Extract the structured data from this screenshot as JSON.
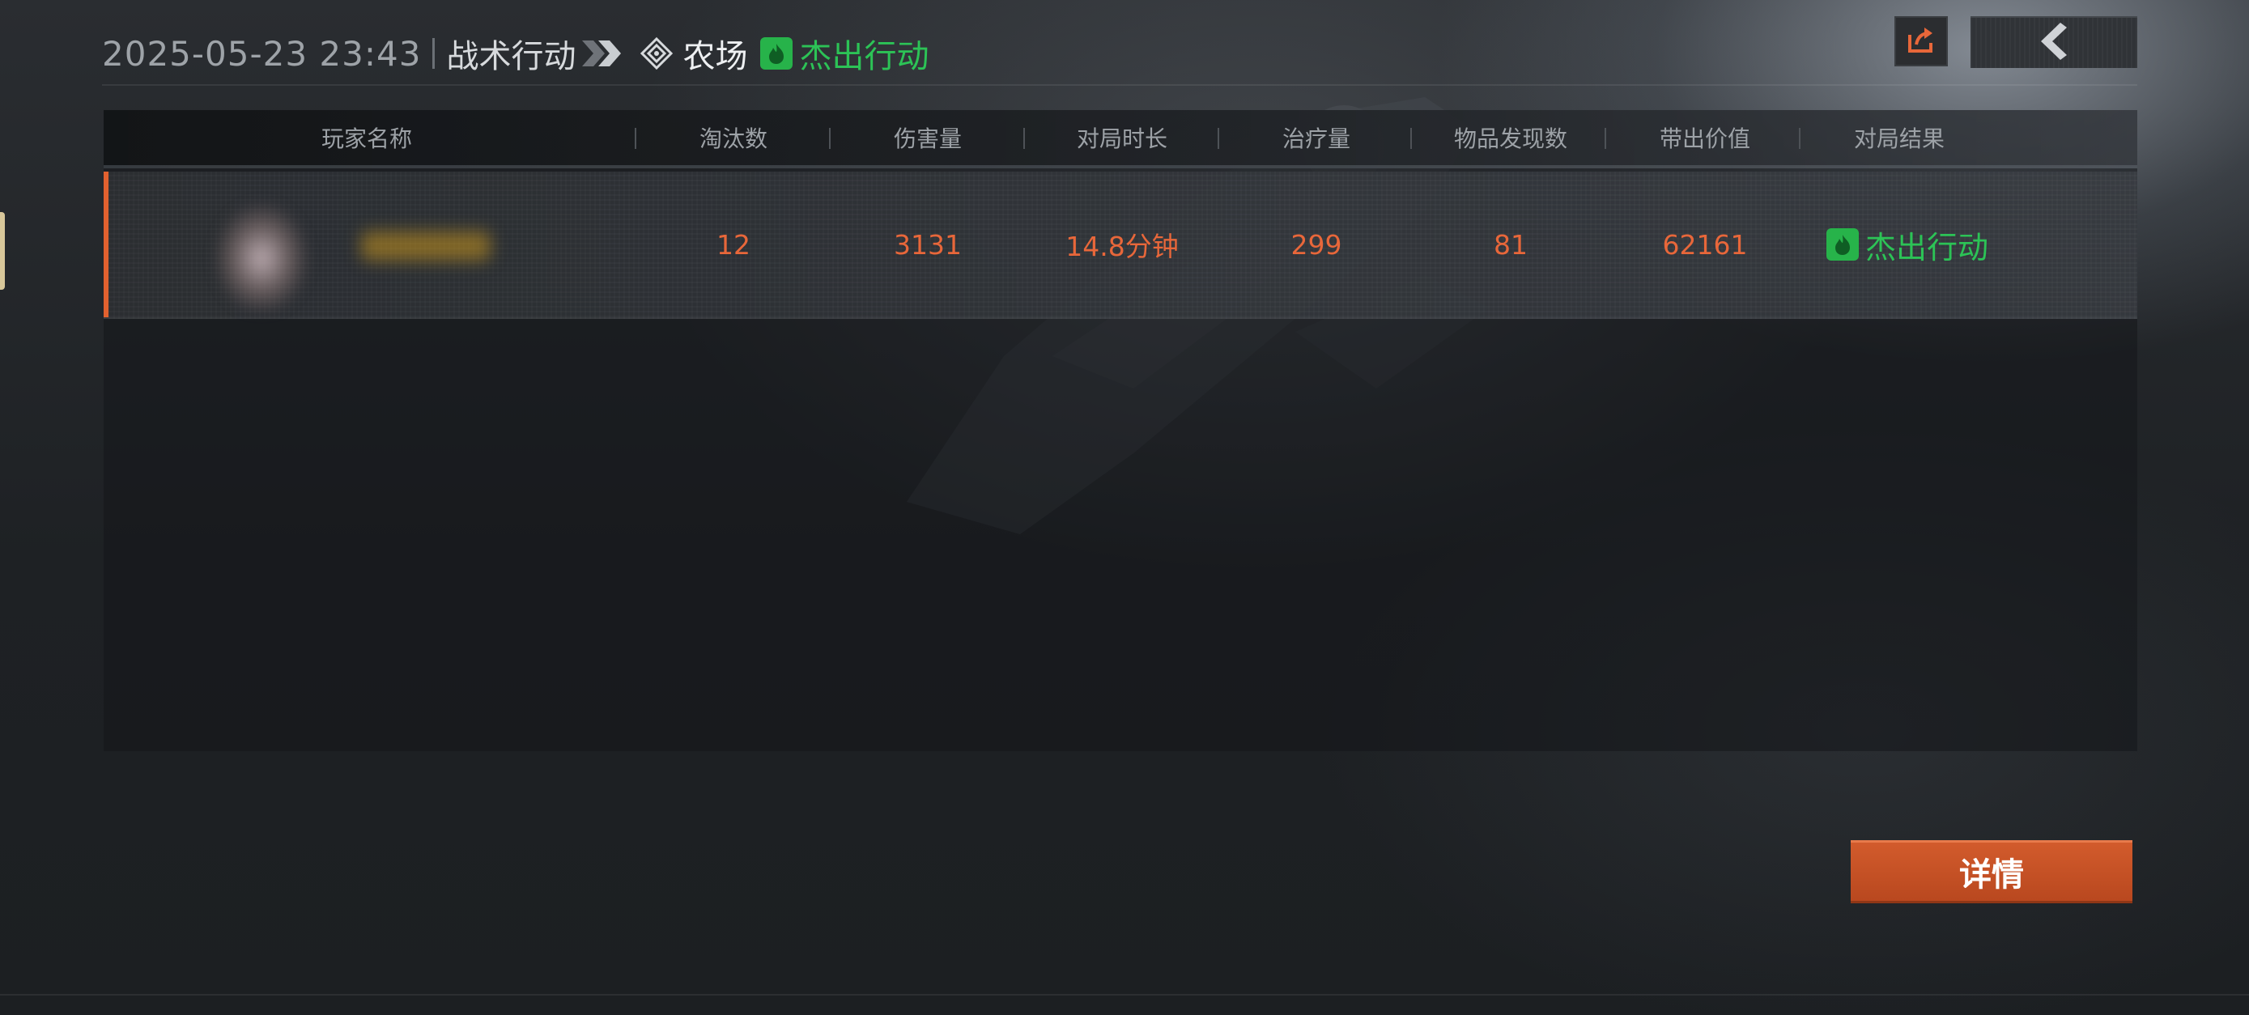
{
  "header": {
    "datetime": "2025-05-23 23:43",
    "mode": "战术行动",
    "map": "农场",
    "result": "杰出行动"
  },
  "colors": {
    "accent": "#e2612f",
    "success": "#2cc356",
    "value": "#e8673a"
  },
  "icons": {
    "share": "share-icon",
    "back": "back-chevron-icon",
    "map": "map-diamond-icon",
    "result": "flame-badge-icon"
  },
  "table": {
    "columns": [
      "玩家名称",
      "淘汰数",
      "伤害量",
      "对局时长",
      "治疗量",
      "物品发现数",
      "带出价值",
      "对局结果"
    ],
    "rows": [
      {
        "eliminations": "12",
        "damage": "3131",
        "duration": "14.8分钟",
        "healing": "299",
        "items_found": "81",
        "extracted_value": "62161",
        "result": "杰出行动"
      }
    ]
  },
  "actions": {
    "details": "详情"
  }
}
